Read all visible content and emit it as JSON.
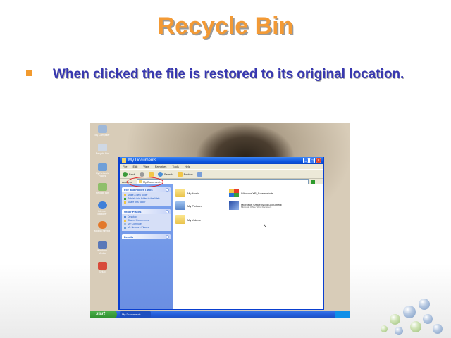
{
  "slide": {
    "title": "Recycle Bin",
    "bullet": "When clicked the file is restored to its original location.",
    "accent_color": "#f39a35",
    "text_color": "#3838b0"
  },
  "screenshot": {
    "desktop_icons": [
      {
        "label": "My Computer",
        "icon": "computer-icon"
      },
      {
        "label": "Recycle Bin",
        "icon": "recycle-bin-icon"
      },
      {
        "label": "My Network Places",
        "icon": "network-icon"
      },
      {
        "label": "Recycle Bin",
        "icon": "recycle-bin-icon"
      },
      {
        "label": "Internet Explorer",
        "icon": "internet-explorer-icon"
      },
      {
        "label": "Mozilla Firefox",
        "icon": "firefox-icon"
      },
      {
        "label": "Windows Media",
        "icon": "media-icon"
      },
      {
        "label": "Setup",
        "icon": "setup-icon"
      }
    ],
    "window": {
      "title": "My Documents",
      "menu": [
        "File",
        "Edit",
        "View",
        "Favorites",
        "Tools",
        "Help"
      ],
      "toolbar": {
        "back": "Back",
        "search": "Search",
        "folders": "Folders"
      },
      "address_label": "Address",
      "address_value": "My Documents",
      "go_label": "Go",
      "task_panes": [
        {
          "title": "File and Folder Tasks",
          "items": [
            "Make a new folder",
            "Publish this folder to the Web",
            "Share this folder"
          ]
        },
        {
          "title": "Other Places",
          "items": [
            "Desktop",
            "Shared Documents",
            "My Computer",
            "My Network Places"
          ]
        },
        {
          "title": "Details",
          "items": []
        }
      ],
      "files": [
        {
          "name": "My Music",
          "desc": "",
          "icon": "music-folder-icon"
        },
        {
          "name": "My Pictures",
          "desc": "",
          "icon": "pictures-folder-icon"
        },
        {
          "name": "My Videos",
          "desc": "",
          "icon": "videos-folder-icon"
        },
        {
          "name": "WindowsXP_Screenshots",
          "desc": "",
          "icon": "folder-icon"
        },
        {
          "name": "Microsoft Office Word Document",
          "desc": "Microsoft Office Word Document",
          "icon": "word-document-icon"
        }
      ]
    },
    "taskbar": {
      "start": "start",
      "task": "My Documents"
    }
  }
}
